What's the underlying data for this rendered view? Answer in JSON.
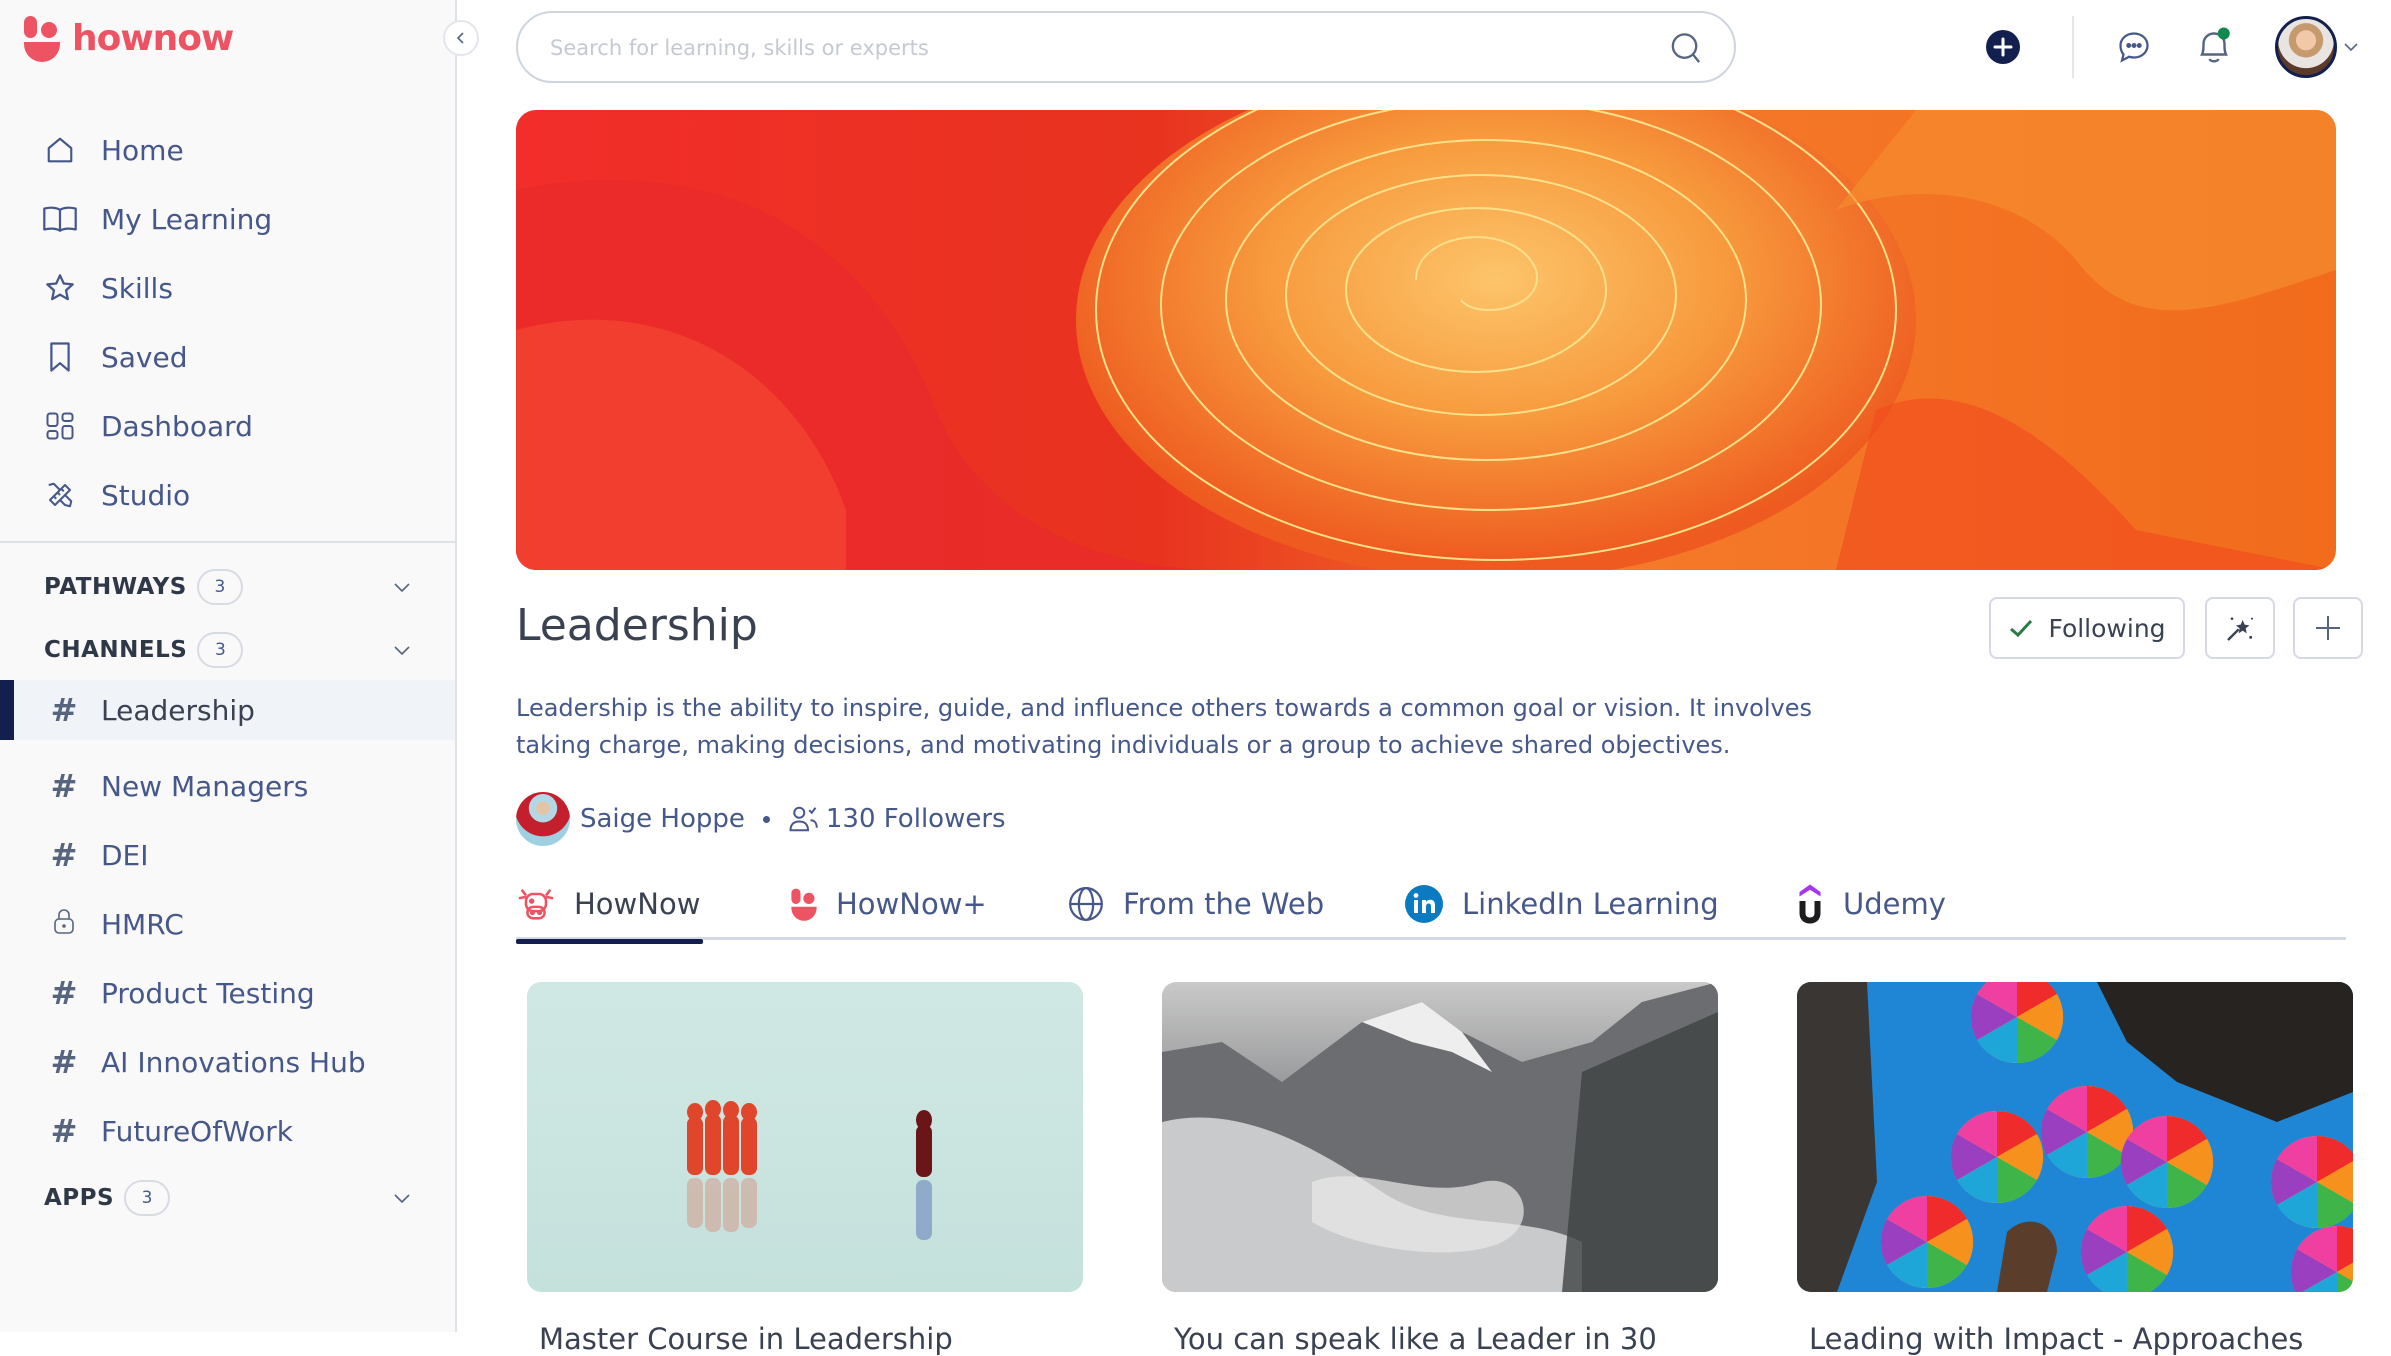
{
  "app": {
    "brand": "hownow",
    "brand_color": "#ee5363",
    "accent_color": "#13204f"
  },
  "sidebar": {
    "collapse_icon": "chevron-left-icon",
    "nav_items": [
      {
        "label": "Home",
        "icon": "home-icon"
      },
      {
        "label": "My Learning",
        "icon": "book-open-icon"
      },
      {
        "label": "Skills",
        "icon": "star-icon"
      },
      {
        "label": "Saved",
        "icon": "bookmark-icon"
      },
      {
        "label": "Dashboard",
        "icon": "grid-icon"
      },
      {
        "label": "Studio",
        "icon": "pencil-ruler-icon"
      }
    ],
    "sections": {
      "pathways": {
        "label": "PATHWAYS",
        "count": "3"
      },
      "channels": {
        "label": "CHANNELS",
        "count": "3"
      },
      "apps": {
        "label": "APPS",
        "count": "3"
      }
    },
    "channels": [
      {
        "label": "Leadership",
        "icon": "hash-icon",
        "active": true
      },
      {
        "label": "New Managers",
        "icon": "hash-icon"
      },
      {
        "label": "DEI",
        "icon": "hash-icon"
      },
      {
        "label": "HMRC",
        "icon": "lock-icon"
      },
      {
        "label": "Product Testing",
        "icon": "hash-icon"
      },
      {
        "label": "AI Innovations Hub",
        "icon": "hash-icon"
      },
      {
        "label": "FutureOfWork",
        "icon": "hash-icon"
      }
    ]
  },
  "header": {
    "search_placeholder": "Search for learning, skills or experts",
    "search_value": "",
    "notification_dot_color": "#0d8a4e"
  },
  "channel": {
    "title": "Leadership",
    "description": "Leadership is the ability to inspire, guide, and influence others towards a common goal or vision. It involves taking charge, making decisions, and motivating individuals or a group to achieve shared objectives.",
    "follow_button": "Following",
    "owner": "Saige Hoppe",
    "followers": "130 Followers"
  },
  "tabs": [
    {
      "label": "HowNow",
      "icon": "hownow-cow-icon",
      "active": true
    },
    {
      "label": "HowNow+",
      "icon": "hownow-logo-icon"
    },
    {
      "label": "From the Web",
      "icon": "globe-icon"
    },
    {
      "label": "LinkedIn Learning",
      "icon": "linkedin-icon"
    },
    {
      "label": "Udemy",
      "icon": "udemy-icon"
    }
  ],
  "cards": [
    {
      "title": "Master Course in Leadership"
    },
    {
      "title": "You can speak like a Leader in 30"
    },
    {
      "title": "Leading with Impact - Approaches"
    }
  ]
}
